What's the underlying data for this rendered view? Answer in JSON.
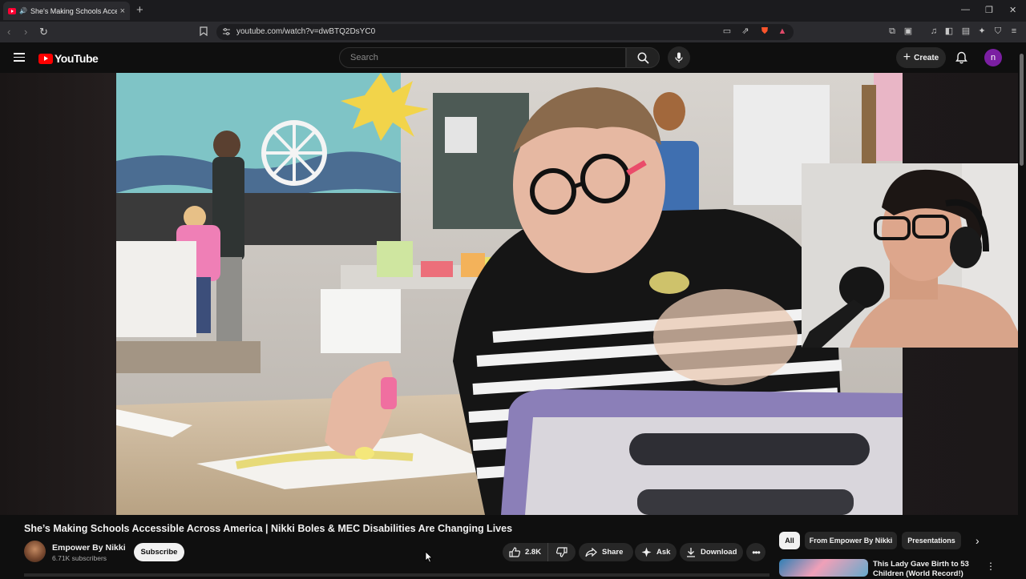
{
  "browser": {
    "tab_title": "She's Making Schools Accessi",
    "url": "youtube.com/watch?v=dwBTQ2DsYC0",
    "new_tab": "+",
    "tab_close": "×"
  },
  "header": {
    "logo_text": "YouTube",
    "search_placeholder": "Search",
    "create_label": "Create",
    "avatar_letter": "n"
  },
  "video": {
    "title": "She’s Making Schools Accessible Across America | Nikki Boles & MEC Disabilities Are Changing Lives",
    "channel_name": "Empower By Nikki",
    "subscribers": "6.71K subscribers",
    "subscribe_label": "Subscribe",
    "like_count": "2.8K",
    "share_label": "Share",
    "ask_label": "Ask",
    "download_label": "Download"
  },
  "chips": [
    {
      "label": "All",
      "active": true
    },
    {
      "label": "From Empower By Nikki",
      "active": false
    },
    {
      "label": "Presentations",
      "active": false
    }
  ],
  "recommendations": [
    {
      "title": "This Lady Gave Birth to 53 Children (World Record!)"
    }
  ],
  "colors": {
    "brand_red": "#ff0000",
    "background": "#0f0f0f",
    "avatar": "#7b1fa2"
  }
}
